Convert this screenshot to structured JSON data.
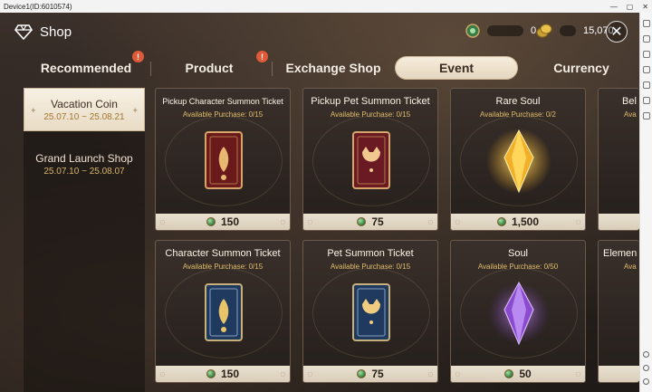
{
  "window": {
    "title": "Device1(ID:6010574)"
  },
  "header": {
    "title": "Shop",
    "currency1_value": "0",
    "currency2_value": "15,070"
  },
  "tabs": [
    {
      "label": "Recommended",
      "badge": "!"
    },
    {
      "label": "Product",
      "badge": "!"
    },
    {
      "label": "Exchange Shop"
    },
    {
      "label": "Event"
    },
    {
      "label": "Currency"
    }
  ],
  "categories": [
    {
      "name": "Vacation Coin",
      "dates": "25.07.10 ~ 25.08.21"
    },
    {
      "name": "Grand Launch Shop",
      "dates": "25.07.10 ~ 25.08.07"
    }
  ],
  "items": [
    {
      "title": "Pickup Character Summon Ticket",
      "avail": "Available Purchase: 0/15",
      "price": "150",
      "icon": "red-card-icon"
    },
    {
      "title": "Pickup Pet Summon Ticket",
      "avail": "Available Purchase: 0/15",
      "price": "75",
      "icon": "red-pet-card-icon"
    },
    {
      "title": "Rare Soul",
      "avail": "Available Purchase: 0/2",
      "price": "1,500",
      "icon": "gold-crystal-icon"
    },
    {
      "title": "Bel",
      "avail": "Ava",
      "price": "",
      "icon": "partial"
    },
    {
      "title": "Character Summon Ticket",
      "avail": "Available Purchase: 0/15",
      "price": "150",
      "icon": "blue-card-icon"
    },
    {
      "title": "Pet Summon Ticket",
      "avail": "Available Purchase: 0/15",
      "price": "75",
      "icon": "blue-pet-card-icon"
    },
    {
      "title": "Soul",
      "avail": "Available Purchase: 0/50",
      "price": "50",
      "icon": "purple-crystal-icon"
    },
    {
      "title": "Elemen",
      "avail": "Ava",
      "price": "",
      "icon": "partial"
    }
  ],
  "colors": {
    "accent_gold": "#e0bd6b",
    "badge_red": "#e05a3a",
    "active_tab_bg": "#f5ecdc"
  }
}
